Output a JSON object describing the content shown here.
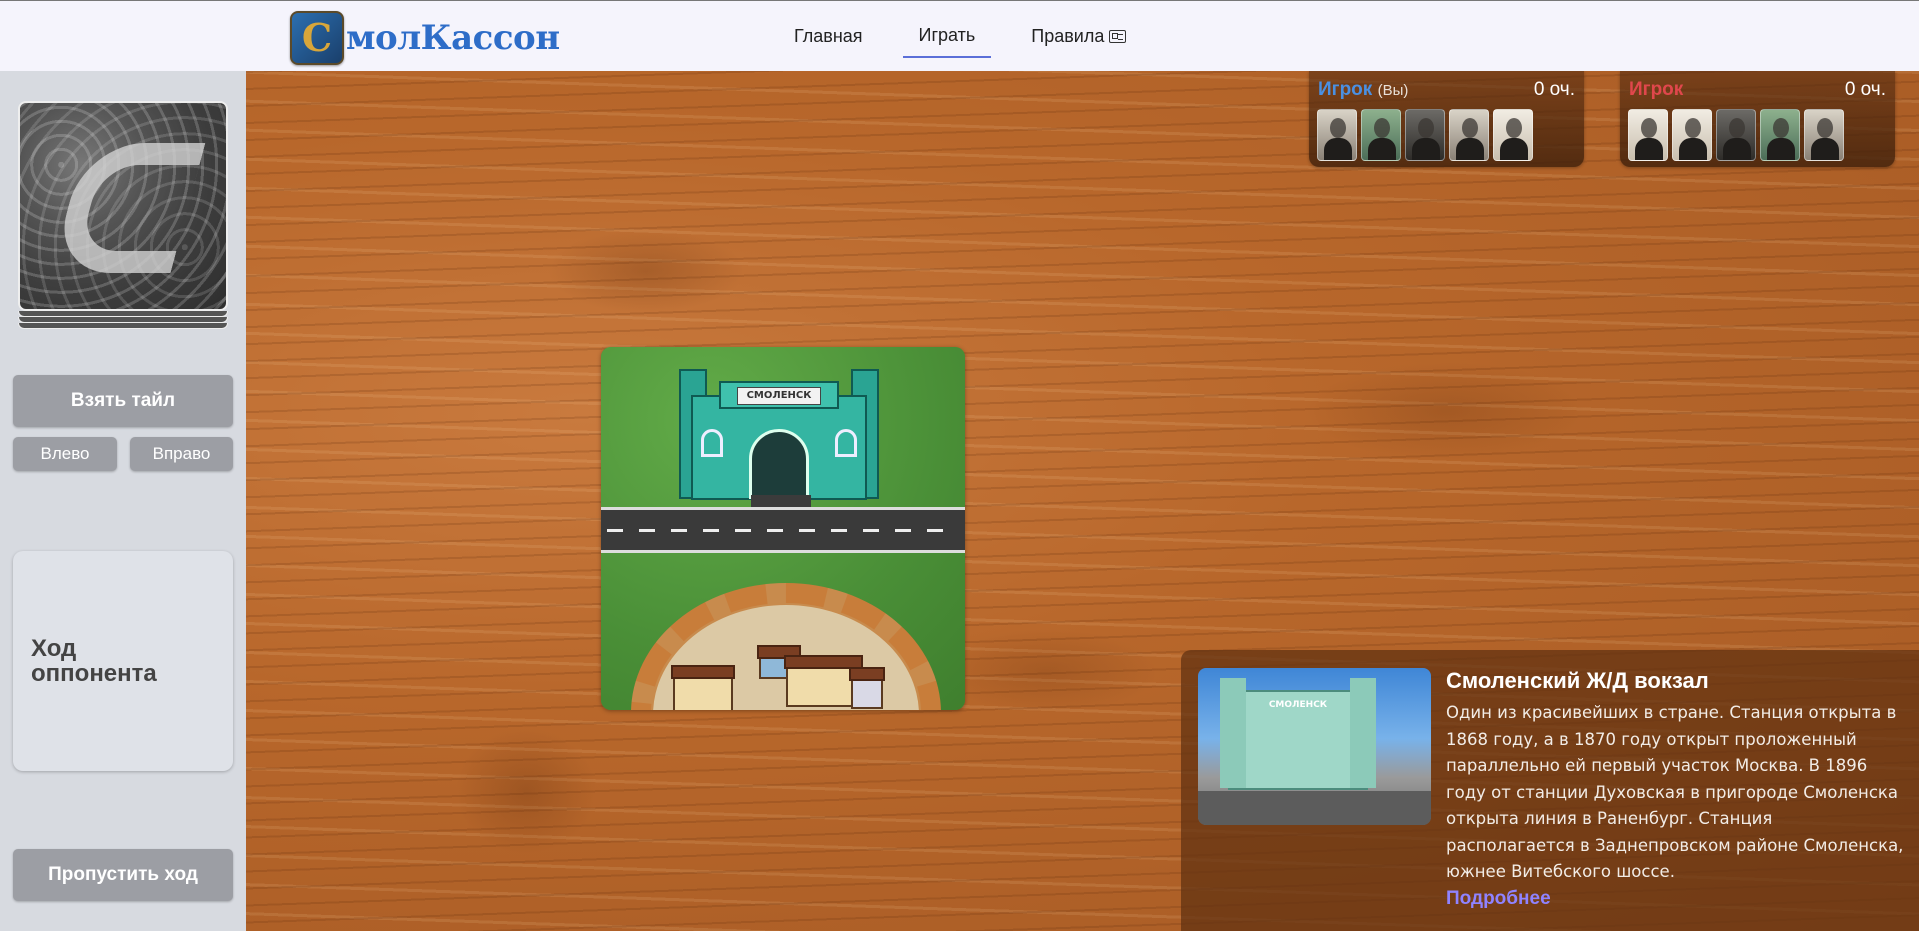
{
  "header": {
    "logo_letter": "C",
    "logo_text": "молКассон",
    "nav": [
      {
        "label": "Главная",
        "active": false
      },
      {
        "label": "Играть",
        "active": true
      },
      {
        "label": "Правила",
        "active": false,
        "icon": "rules-card-icon"
      }
    ]
  },
  "sidebar": {
    "deck_icon": "tile-deck-icon",
    "take_tile": "Взять тайл",
    "rotate_left": "Влево",
    "rotate_right": "Вправо",
    "turn_status": "Ход оппонента",
    "skip_turn": "Пропустить ход"
  },
  "tile": {
    "station_sign": "СМОЛЕНСК"
  },
  "players": [
    {
      "name": "Игрок",
      "you_tag": "(Вы)",
      "score": "0 оч.",
      "color": "#4a90e2",
      "meeples": [
        "light",
        "green",
        "dark",
        "light",
        "light"
      ]
    },
    {
      "name": "Игрок",
      "you_tag": "",
      "score": "0 оч.",
      "color": "#e0474c",
      "meeples": [
        "light",
        "light",
        "dark",
        "green",
        "light"
      ]
    }
  ],
  "info_card": {
    "photo_sign": "СМОЛЕНСК",
    "title": "Смоленский Ж/Д вокзал",
    "description": "Один из красивейших в стране. Станция открыта в 1868 году, а в 1870 году открыт проложенный параллельно ей первый участок Москва. В 1896 году от станции Духовская в пригороде Смоленска открыта линия в Раненбург. Станция располагается в Заднепровском районе Смоленска, южнее Витебского шоссе.",
    "more_link": "Подробнее"
  }
}
